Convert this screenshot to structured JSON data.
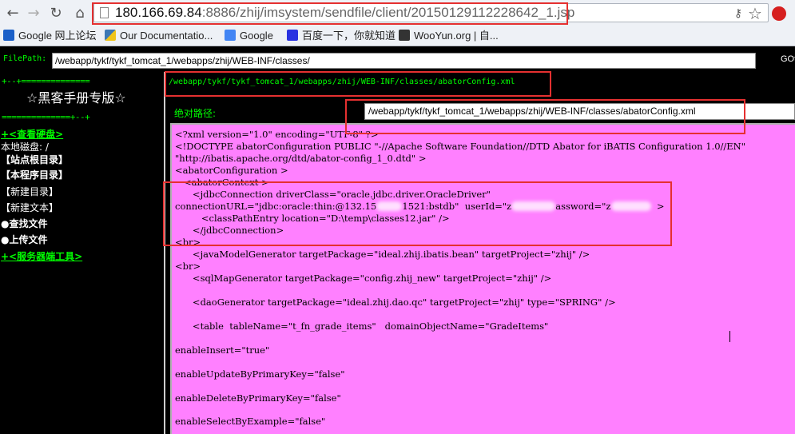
{
  "browser": {
    "url_host": "180.166.69.84",
    "url_rest": ":8886/zhij/imsystem/sendfile/client/20150129112228642_1.jsp"
  },
  "bookmarks": [
    {
      "label": "Google 网上论坛",
      "color": "#1a5fc8"
    },
    {
      "label": "Our Documentatio...",
      "color": "#3c78b5"
    },
    {
      "label": "Google",
      "color": "#4285f4"
    },
    {
      "label": "百度一下，你就知道",
      "color": "#2932e1"
    },
    {
      "label": "WooYun.org | 自...",
      "color": "#333333"
    }
  ],
  "filepath": {
    "label": "FilePath:",
    "value": "/webapp/tykf/tykf_tomcat_1/webapps/zhij/WEB-INF/classes/",
    "go_label": "GOt"
  },
  "sidebar": {
    "sep_top": "+--+==============",
    "title": "☆黑客手册专版☆",
    "sep_bottom": "==============+--+",
    "items": [
      {
        "label": "+<查看硬盘>",
        "style": "green"
      },
      {
        "label": "本地磁盘: /",
        "style": "norm"
      },
      {
        "label": "【站点根目录】",
        "style": "bold"
      },
      {
        "label": "【本程序目录】",
        "style": "bold"
      },
      {
        "label": "【新建目录】",
        "style": "norm"
      },
      {
        "label": "【新建文本】",
        "style": "norm"
      },
      {
        "label": "●查找文件",
        "style": "bold"
      },
      {
        "label": "●上传文件",
        "style": "bold"
      },
      {
        "label": "+<服务器端工具>",
        "style": "green"
      }
    ]
  },
  "content": {
    "path_line": "/webapp/tykf/tykf_tomcat_1/webapps/zhij/WEB-INF/classes/abatorConfig.xml",
    "abs_label": "绝对路径:",
    "abs_value": "/webapp/tykf/tykf_tomcat_1/webapps/zhij/WEB-INF/classes/abatorConfig.xml"
  },
  "code": [
    "<?xml version=\"1.0\" encoding=\"UTF-8\" ?>",
    "<!DOCTYPE abatorConfiguration PUBLIC \"-//Apache Software Foundation//DTD Abator for iBATIS Configuration 1.0//EN\"",
    "\"http://ibatis.apache.org/dtd/abator-config_1_0.dtd\" >",
    "<abatorConfiguration >",
    "   <abatorContext >",
    "      <jdbcConnection driverClass=\"oracle.jdbc.driver.OracleDriver\"",
    "connectionURL=\"jdbc:oracle:thin:@132.15",
    "         <classPathEntry location=\"D:\\temp\\classes12.jar\" />",
    "      </jdbcConnection>",
    "<br>",
    "      <javaModelGenerator targetPackage=\"ideal.zhij.ibatis.bean\" targetProject=\"zhij\" />",
    "<br>",
    "      <sqlMapGenerator targetPackage=\"config.zhij_new\" targetProject=\"zhij\" />",
    "      <daoGenerator targetPackage=\"ideal.zhij.dao.qc\" targetProject=\"zhij\" type=\"SPRING\" />",
    "      <table  tableName=\"t_fn_grade_items\"   domainObjectName=\"GradeItems\"",
    "enableInsert=\"true\"",
    "enableUpdateByPrimaryKey=\"false\"",
    "enableDeleteByPrimaryKey=\"false\"",
    "enableSelectByExample=\"false\""
  ],
  "code_fragments": {
    "url_tail": "1521:bstdb\"  userId=\"z",
    "pwd_tail": "assword=\"z",
    "close_tag": ">"
  }
}
